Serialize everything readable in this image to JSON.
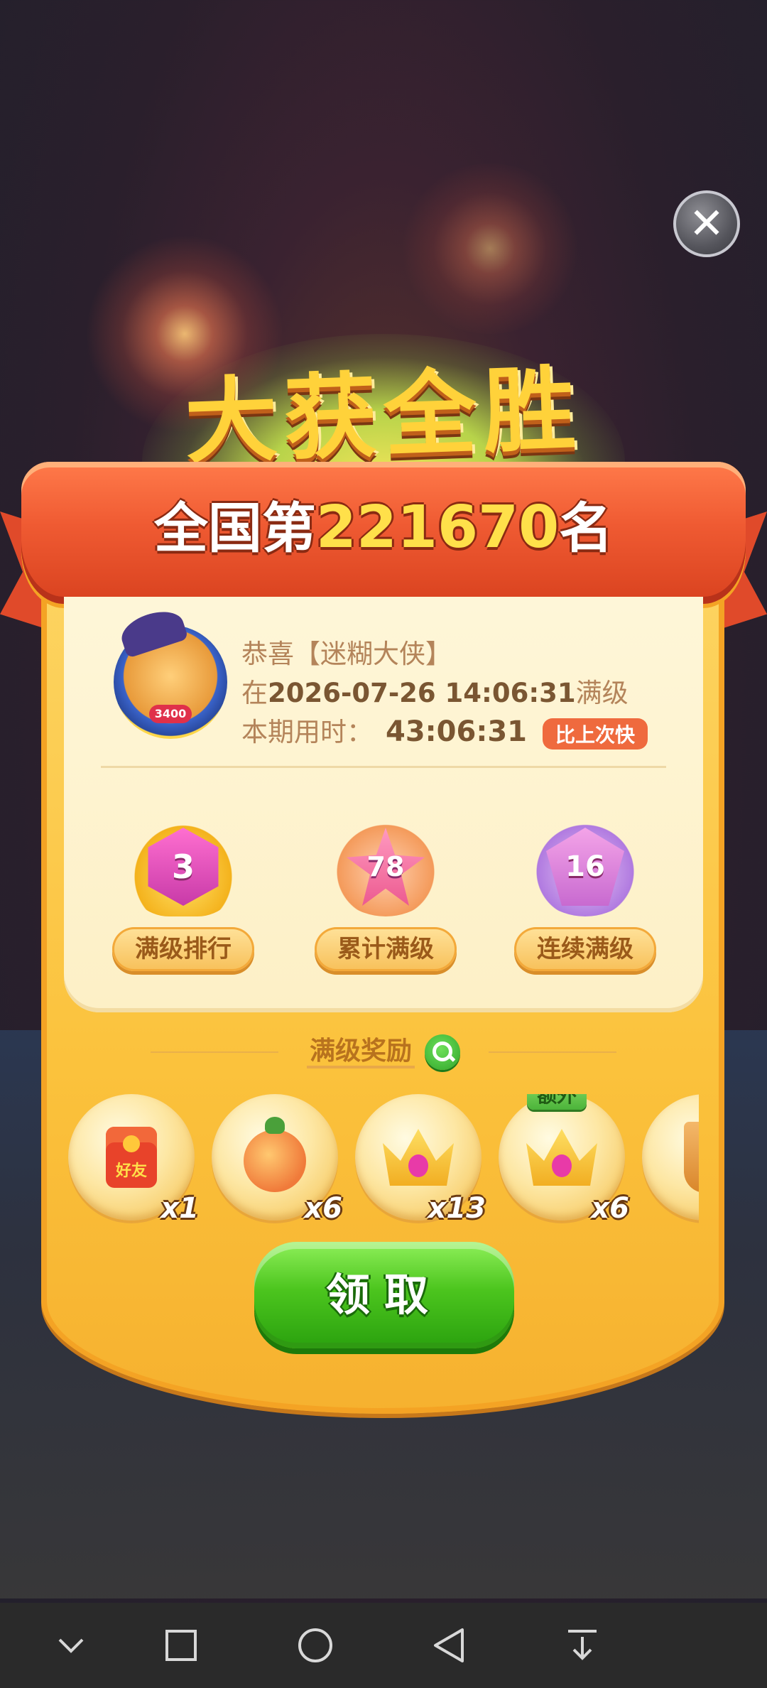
{
  "title": "大获全胜",
  "ribbon": {
    "prefix": "全国第",
    "rank": "221670",
    "suffix": "名"
  },
  "info": {
    "congrats": "恭喜【迷糊大侠】",
    "line2_prefix": "在",
    "datetime": "2026-07-26 14:06:31",
    "line2_suffix": "满级",
    "duration_label": "本期用时：",
    "duration": "43:06:31",
    "faster_badge": "比上次快",
    "avatar_level": "3400"
  },
  "stats": [
    {
      "value": "3",
      "label": "满级排行"
    },
    {
      "value": "78",
      "label": "累计满级"
    },
    {
      "value": "16",
      "label": "连续满级"
    }
  ],
  "rewards_title": "满级奖励",
  "rewards": [
    {
      "icon": "red-envelope-icon",
      "icon_text": "好友",
      "qty": "x1",
      "extra": ""
    },
    {
      "icon": "bomb-booster-icon",
      "qty": "x6",
      "extra": ""
    },
    {
      "icon": "crown-icon",
      "qty": "x13",
      "extra": ""
    },
    {
      "icon": "crown-icon",
      "qty": "x6",
      "extra": "额外"
    },
    {
      "icon": "trophy-icon",
      "qty": "",
      "extra": ""
    }
  ],
  "claim_label": "领取",
  "nav": [
    "chevron-down-icon",
    "square-icon",
    "circle-icon",
    "triangle-back-icon",
    "download-icon"
  ]
}
